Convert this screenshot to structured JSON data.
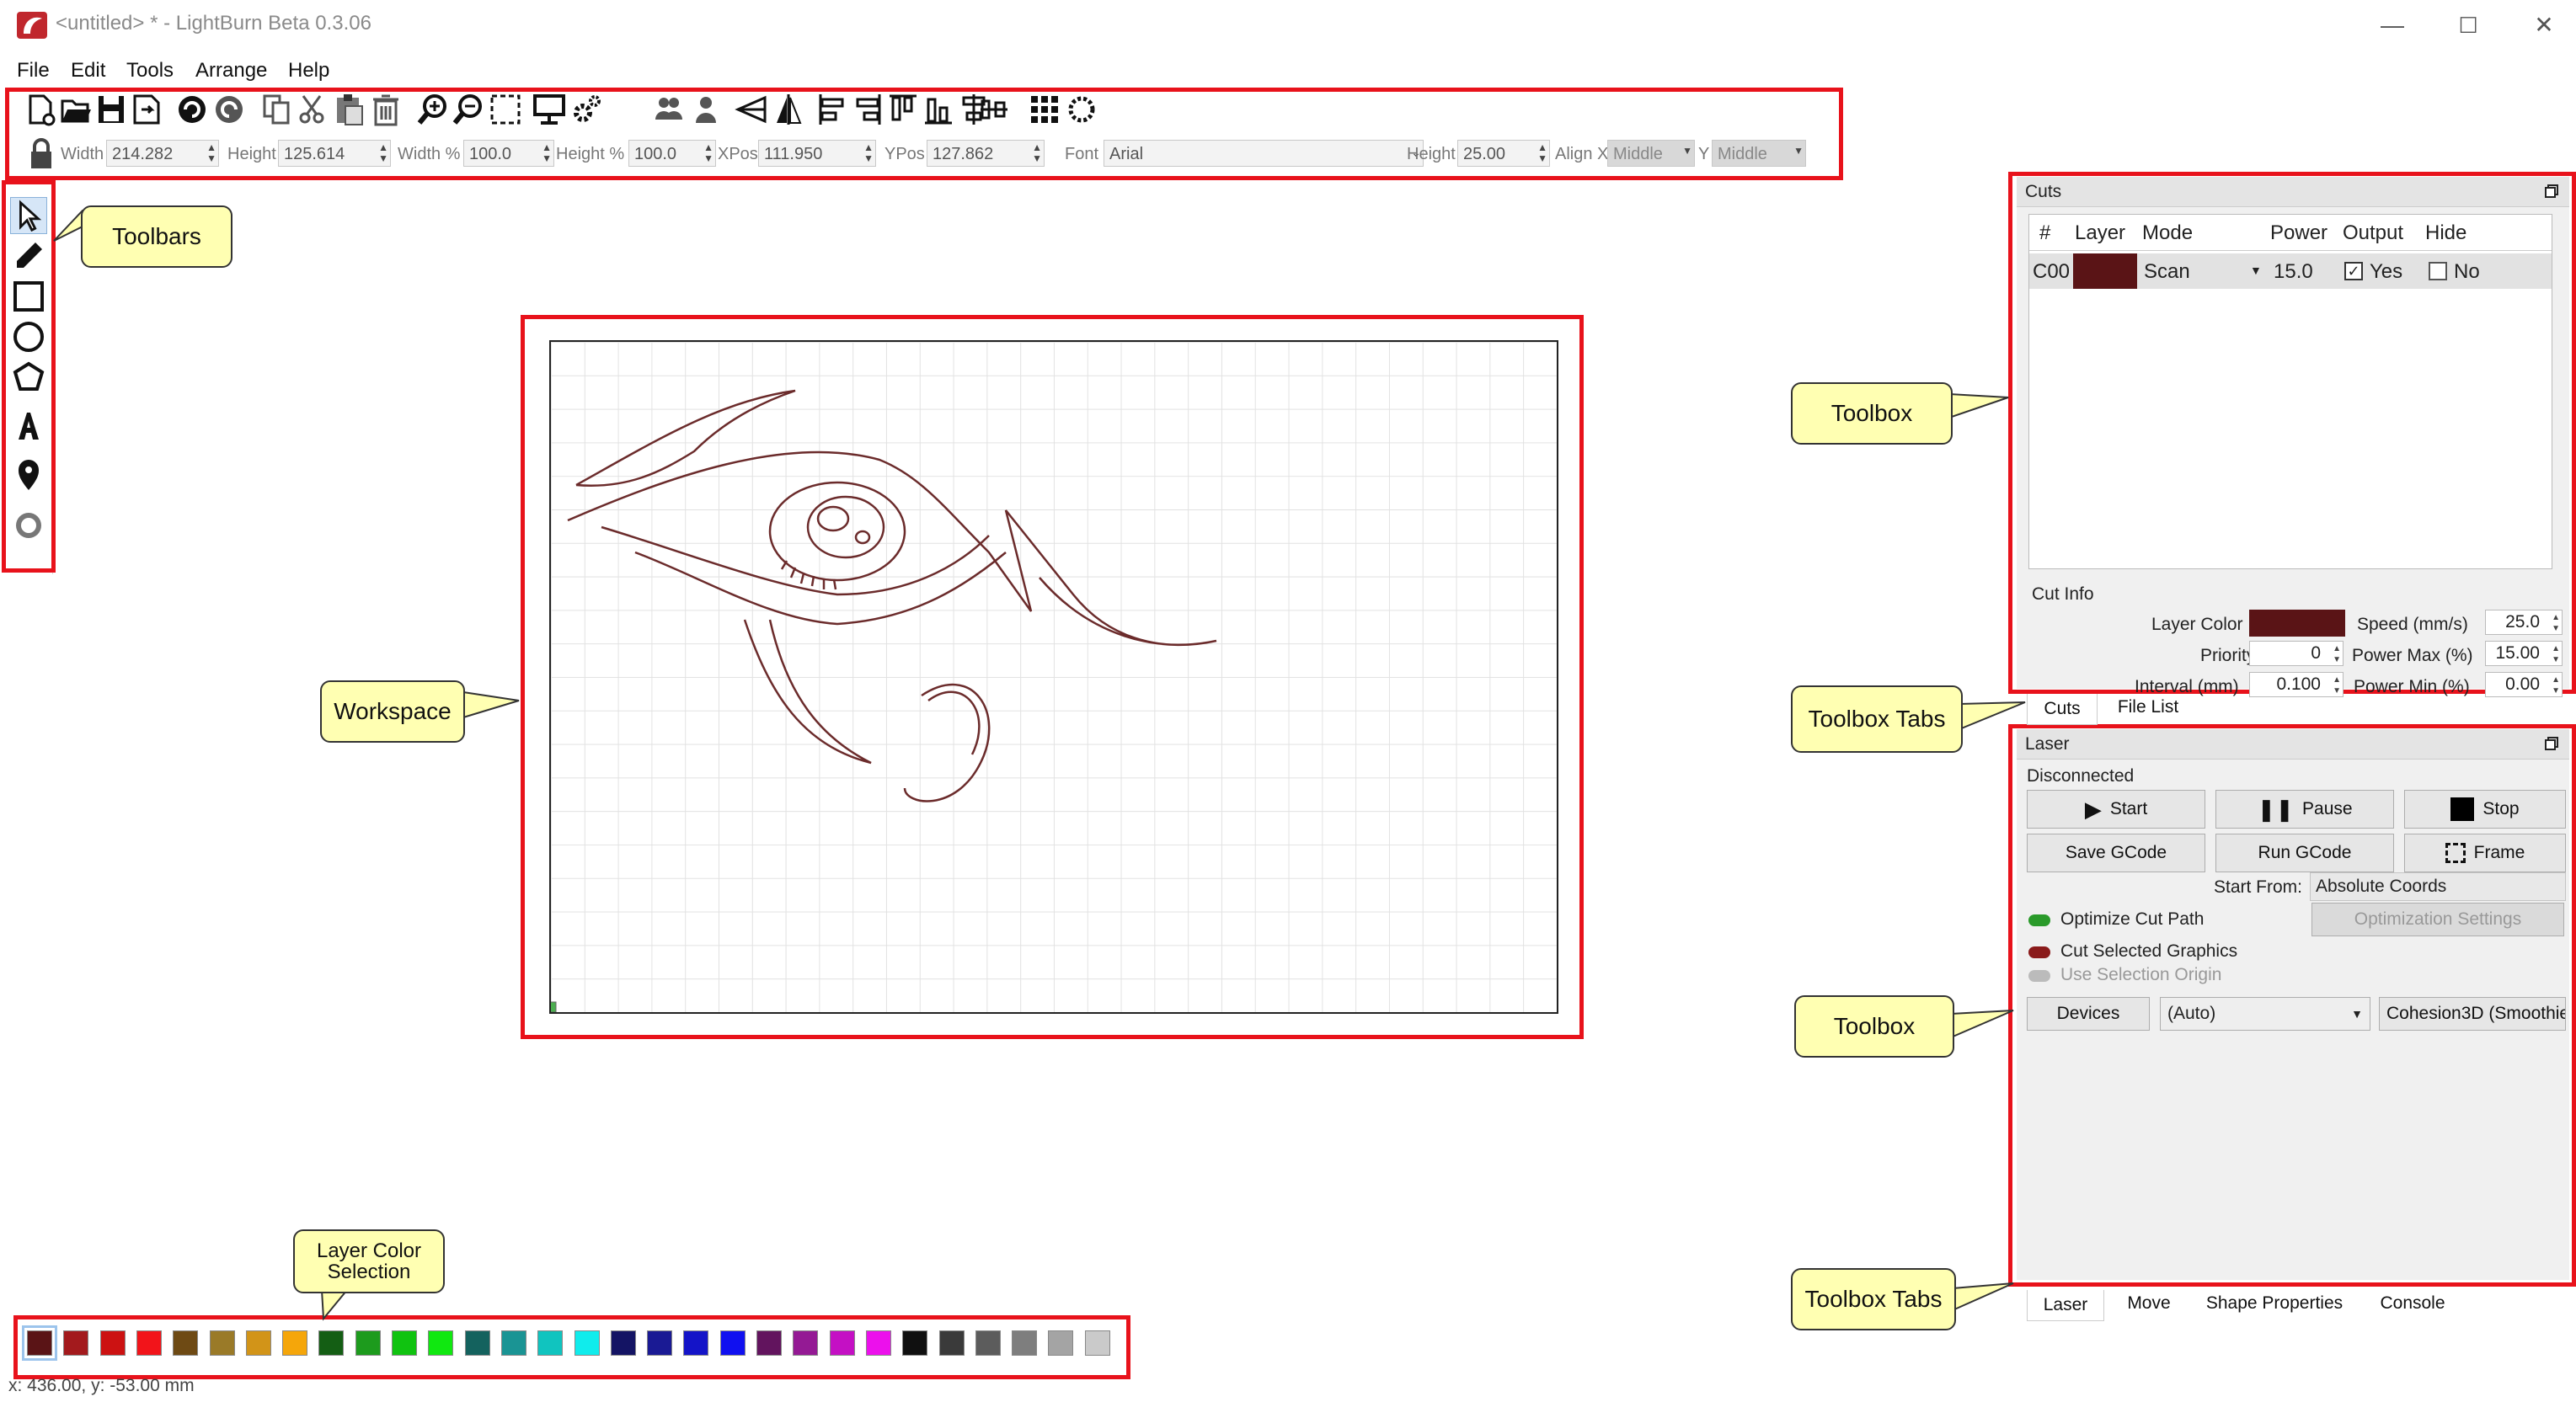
{
  "window": {
    "title": "<untitled> * - LightBurn Beta 0.3.06",
    "minimize": "—",
    "maximize": "☐",
    "close": "✕"
  },
  "menu": [
    "File",
    "Edit",
    "Tools",
    "Arrange",
    "Help"
  ],
  "toolbar_icons": [
    "new-file-icon",
    "open-folder-icon",
    "save-icon",
    "save-as-icon",
    "undo-icon",
    "redo-icon",
    "copy-icon",
    "cut-icon",
    "paste-icon",
    "delete-icon",
    "zoom-in-icon",
    "zoom-out-icon",
    "zoom-frame-icon",
    "monitor-icon",
    "settings-gear-icon",
    "group-icon",
    "ungroup-icon",
    "mirror-horizontal-icon",
    "mirror-vertical-icon",
    "align-left-icon",
    "align-right-icon",
    "align-top-icon",
    "align-bottom-icon",
    "align-center-vertical-icon",
    "align-center-horizontal-icon",
    "grid-array-icon",
    "circular-array-icon"
  ],
  "props": {
    "width_label": "Width",
    "width": "214.282",
    "height_label": "Height",
    "height": "125.614",
    "width_pct_label": "Width %",
    "width_pct": "100.0",
    "height_pct_label": "Height %",
    "height_pct": "100.0",
    "xpos_label": "XPos",
    "xpos": "111.950",
    "ypos_label": "YPos",
    "ypos": "127.862",
    "font_label": "Font",
    "font": "Arial",
    "text_height_label": "Height",
    "text_height": "25.00",
    "alignx_label": "Align X",
    "alignx": "Middle",
    "aligny_label": "Y",
    "aligny": "Middle"
  },
  "left_tools": [
    "select-arrow-icon",
    "pencil-icon",
    "rectangle-icon",
    "ellipse-icon",
    "polygon-icon",
    "text-tool-icon",
    "position-pin-icon",
    "offset-ring-icon"
  ],
  "callouts": {
    "toolbars": "Toolbars",
    "workspace": "Workspace",
    "toolbox_top": "Toolbox",
    "toolbox_tabs_top": "Toolbox Tabs",
    "toolbox_bottom": "Toolbox",
    "toolbox_tabs_bottom": "Toolbox Tabs",
    "layer_color_line1": "Layer Color",
    "layer_color_line2": "Selection"
  },
  "cuts": {
    "title": "Cuts",
    "headers": [
      "#",
      "Layer",
      "Mode",
      "Power",
      "Output",
      "Hide"
    ],
    "row": {
      "id": "C00",
      "layer_color": "#5a1416",
      "mode": "Scan",
      "power": "15.0",
      "output": "Yes",
      "output_checked": true,
      "hide": "No",
      "hide_checked": false
    },
    "cut_info_title": "Cut Info",
    "layer_color_label": "Layer Color",
    "speed_label": "Speed (mm/s)",
    "speed": "25.0",
    "priority_label": "Priority",
    "priority": "0",
    "power_max_label": "Power Max (%)",
    "power_max": "15.00",
    "interval_label": "Interval (mm)",
    "interval": "0.100",
    "power_min_label": "Power Min (%)",
    "power_min": "0.00"
  },
  "tabs_top": [
    "Cuts",
    "File List"
  ],
  "laser": {
    "title": "Laser",
    "status": "Disconnected",
    "start": "Start",
    "pause": "Pause",
    "stop": "Stop",
    "save_gcode": "Save GCode",
    "run_gcode": "Run GCode",
    "frame": "Frame",
    "start_from_label": "Start From:",
    "start_from": "Absolute Coords",
    "optimize_label": "Optimize Cut Path",
    "optimization_settings": "Optimization Settings",
    "cut_selected_label": "Cut Selected Graphics",
    "use_selection_origin_label": "Use Selection Origin",
    "devices": "Devices",
    "port": "(Auto)",
    "device_name": "Cohesion3D (Smoothie"
  },
  "tabs_bottom": [
    "Laser",
    "Move",
    "Shape Properties",
    "Console"
  ],
  "palette": [
    "#5a1416",
    "#a31a1d",
    "#cc1212",
    "#f2141a",
    "#6e4a14",
    "#9a7a28",
    "#d29418",
    "#f5a60a",
    "#145e14",
    "#1d9b1d",
    "#10c310",
    "#10e810",
    "#14625e",
    "#1a9494",
    "#10c4bf",
    "#10ecec",
    "#141464",
    "#1a1a94",
    "#1414c8",
    "#1010f0",
    "#62145e",
    "#941a94",
    "#c410c4",
    "#ec10ec",
    "#101010",
    "#3a3a3a",
    "#5c5c5c",
    "#7e7e7e",
    "#a4a4a4",
    "#cacaca"
  ],
  "status": "x: 436.00, y: -53.00 mm"
}
